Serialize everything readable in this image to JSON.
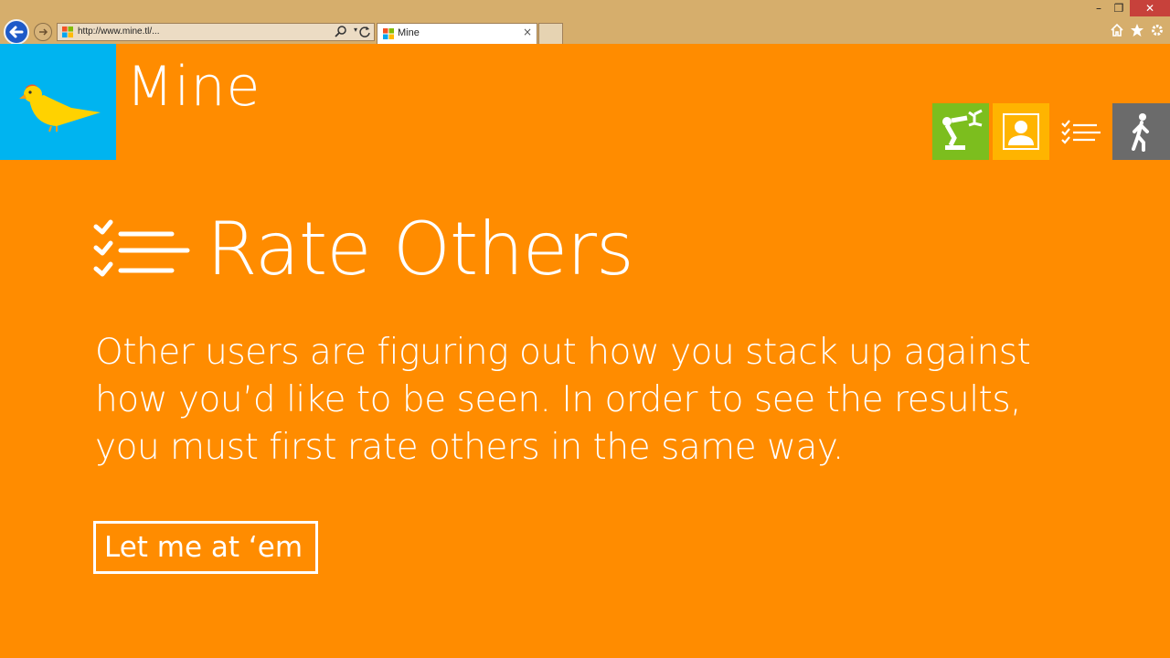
{
  "browser": {
    "address": "http://www.mine.tl/...",
    "tab_title": "Mine",
    "tab_close": "×",
    "minimize": "–",
    "restore": "❐",
    "close": "✕"
  },
  "app": {
    "title": "Mine"
  },
  "nav": {
    "robot_icon": "robot-arm-icon",
    "profile_icon": "profile-icon",
    "rate_icon": "checklist-icon",
    "exit_icon": "walking-person-icon"
  },
  "page": {
    "heading": "Rate Others",
    "body_line1": "Other users are figuring out how you stack up against",
    "body_line2": "how you’d like to be seen. In order to see the results,",
    "body_line3": "you must first rate others in the same way.",
    "cta_label": "Let me at ‘em"
  },
  "colors": {
    "background": "#ff8c00",
    "logo_tile": "#00b4f0",
    "robot_tile": "#7cbe1e",
    "profile_tile": "#ffb400",
    "exit_tile": "#6b6b6b"
  }
}
